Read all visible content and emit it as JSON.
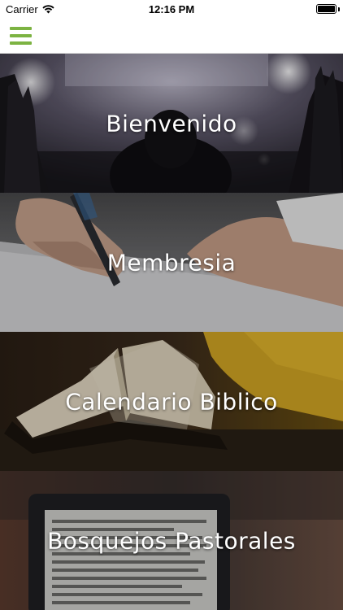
{
  "status_bar": {
    "carrier": "Carrier",
    "time": "12:16 PM",
    "battery_level": 1.0
  },
  "nav": {
    "menu_icon": "hamburger-menu-icon",
    "accent_color": "#7cb342"
  },
  "cards": [
    {
      "title": "Bienvenido"
    },
    {
      "title": "Membresia"
    },
    {
      "title": "Calendario Biblico"
    },
    {
      "title": "Bosquejos Pastorales"
    }
  ]
}
